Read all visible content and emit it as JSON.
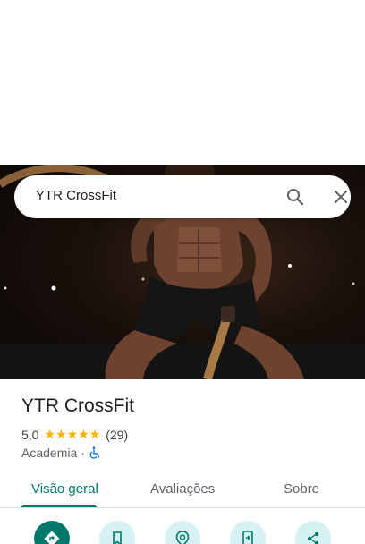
{
  "search": {
    "value": "YTR CrossFit"
  },
  "place": {
    "title": "YTR CrossFit",
    "rating": "5,0",
    "stars": "★★★★★",
    "review_count": "(29)",
    "category": "Academia",
    "separator": "·"
  },
  "tabs": [
    {
      "label": "Visão geral"
    },
    {
      "label": "Avaliações"
    },
    {
      "label": "Sobre"
    }
  ],
  "actions": [
    {
      "icon": "directions-icon"
    },
    {
      "icon": "save-icon"
    },
    {
      "icon": "nearby-icon"
    },
    {
      "icon": "send-to-phone-icon"
    },
    {
      "icon": "share-icon"
    }
  ],
  "colors": {
    "accent": "#00796b",
    "action_bg": "#d6f1f3",
    "star": "#f5b400"
  }
}
